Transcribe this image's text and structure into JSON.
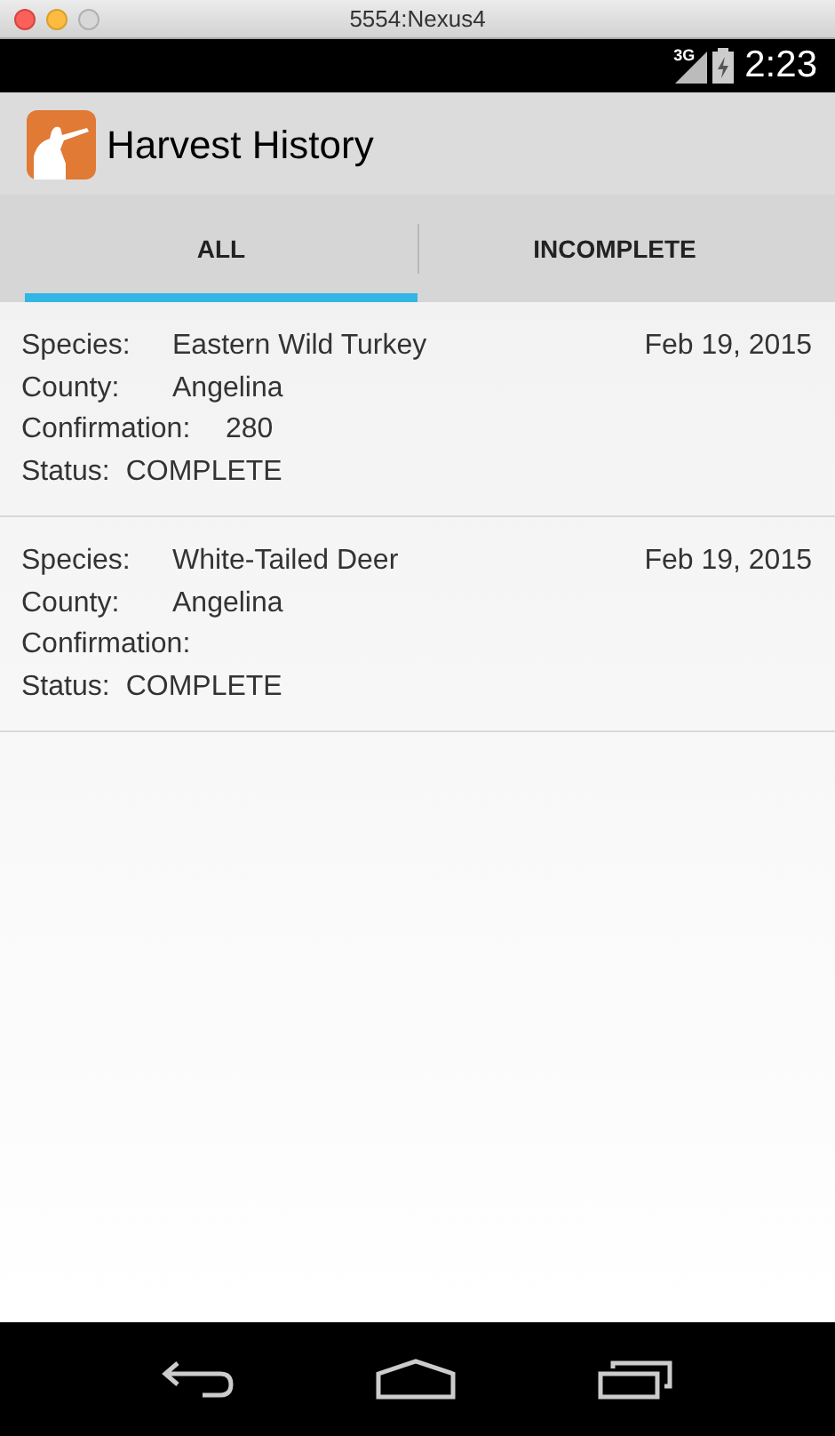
{
  "window": {
    "title": "5554:Nexus4"
  },
  "status_bar": {
    "network": "3G",
    "time": "2:23"
  },
  "action_bar": {
    "title": "Harvest History"
  },
  "tabs": [
    {
      "label": "ALL",
      "selected": true
    },
    {
      "label": "INCOMPLETE",
      "selected": false
    }
  ],
  "harvests": [
    {
      "date": "Feb 19, 2015",
      "fields": [
        {
          "label": "Species:",
          "value": "Eastern Wild Turkey"
        },
        {
          "label": "County:",
          "value": "Angelina"
        },
        {
          "label": "Confirmation:",
          "value": "280"
        },
        {
          "label": "Status:",
          "value": "COMPLETE"
        }
      ]
    },
    {
      "date": "Feb 19, 2015",
      "fields": [
        {
          "label": "Species:",
          "value": "White-Tailed Deer"
        },
        {
          "label": "County:",
          "value": "Angelina"
        },
        {
          "label": "Confirmation:"
        },
        {
          "label": "Status:",
          "value": "COMPLETE"
        }
      ]
    }
  ]
}
